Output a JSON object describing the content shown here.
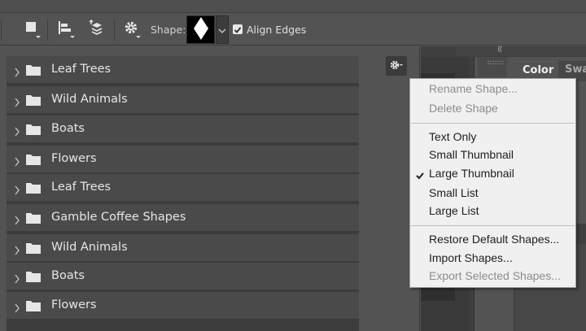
{
  "options_bar": {
    "shape_label": "Shape:",
    "align_edges_label": "Align Edges",
    "align_edges_checked": true
  },
  "panel": {
    "folders": [
      {
        "label": "Leaf Trees"
      },
      {
        "label": "Wild Animals"
      },
      {
        "label": "Boats"
      },
      {
        "label": "Flowers"
      },
      {
        "label": "Leaf Trees"
      },
      {
        "label": "Gamble Coffee Shapes"
      },
      {
        "label": "Wild Animals"
      },
      {
        "label": "Boats"
      },
      {
        "label": "Flowers"
      }
    ]
  },
  "right_panel": {
    "tabs": [
      "Color",
      "Swa"
    ]
  },
  "context_menu": {
    "items": [
      {
        "label": "Rename Shape...",
        "enabled": false
      },
      {
        "label": "Delete Shape",
        "enabled": false
      },
      {
        "label": "Text Only",
        "enabled": true
      },
      {
        "label": "Small Thumbnail",
        "enabled": true
      },
      {
        "label": "Large Thumbnail",
        "enabled": true,
        "checked": true
      },
      {
        "label": "Small List",
        "enabled": true
      },
      {
        "label": "Large List",
        "enabled": true
      },
      {
        "label": "Restore Default Shapes...",
        "enabled": true
      },
      {
        "label": "Import Shapes...",
        "enabled": true
      },
      {
        "label": "Export Selected Shapes...",
        "enabled": false
      }
    ]
  },
  "colors": {
    "panel_bg": "#535353",
    "row_bg": "#4a4a4a",
    "menu_bg": "#f0f0f0",
    "menu_disabled_text": "#8c8c8c"
  }
}
